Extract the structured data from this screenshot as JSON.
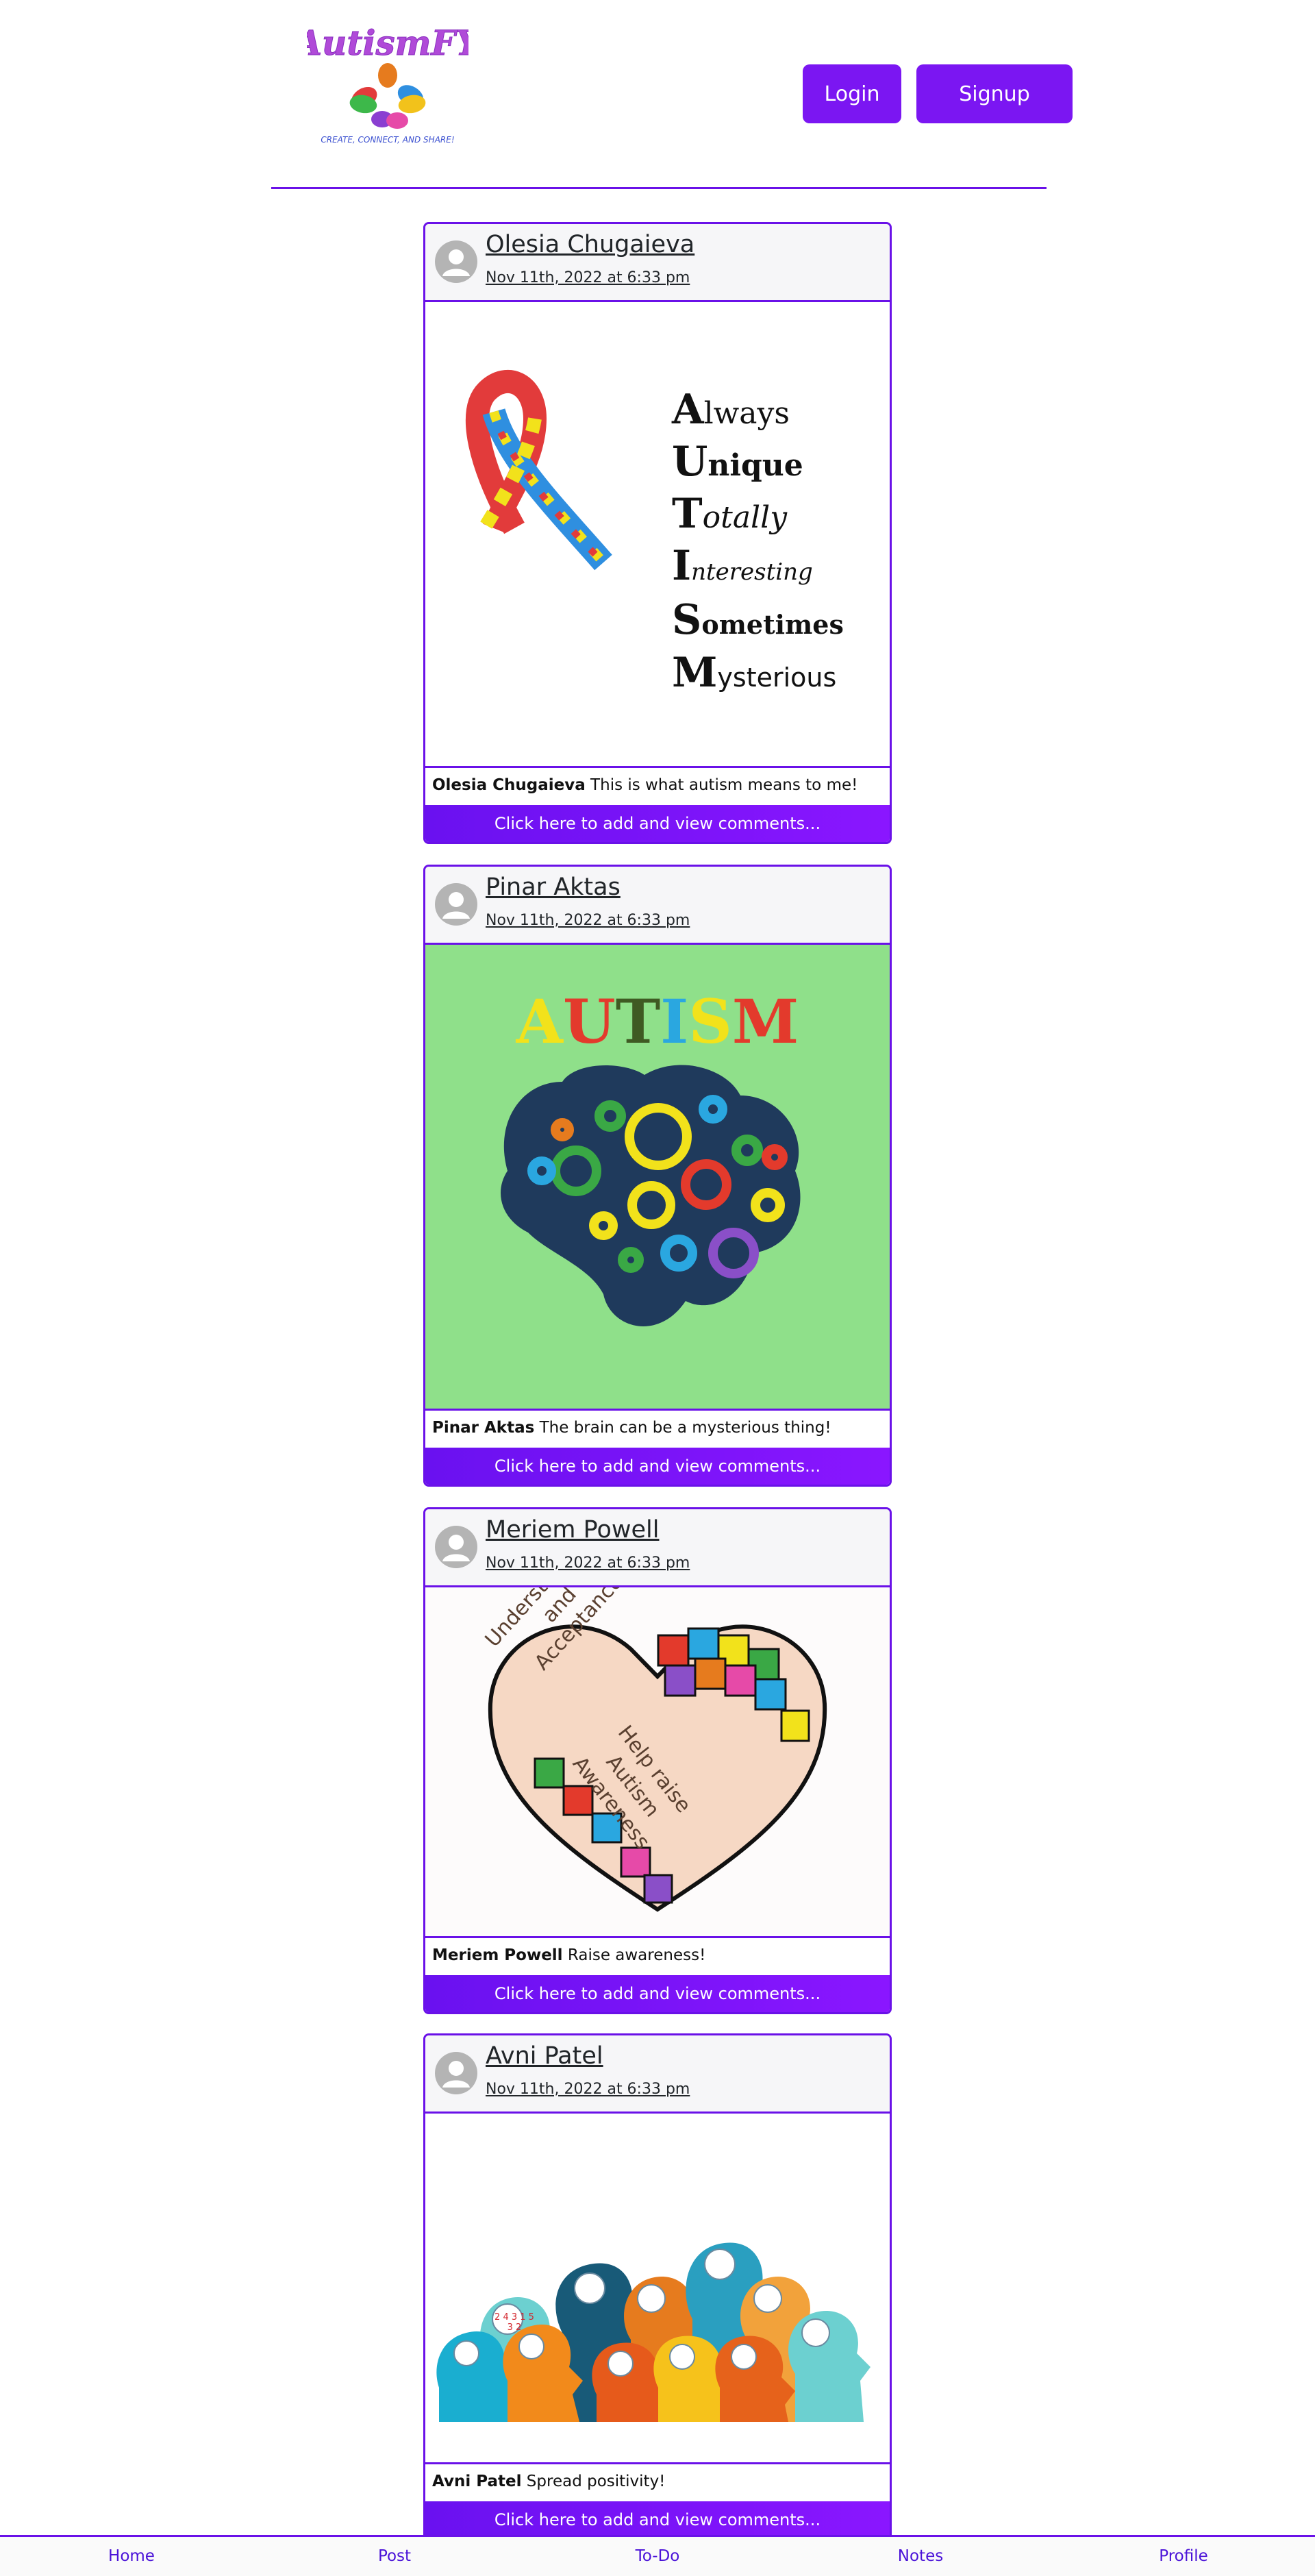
{
  "header": {
    "logo_text": "AutismFY",
    "logo_tagline": "CREATE, CONNECT, AND SHARE!",
    "login_label": "Login",
    "signup_label": "Signup"
  },
  "posts": [
    {
      "author": "Olesia Chugaieva",
      "date": "Nov 11th, 2022 at 6:33 pm",
      "caption_author": "Olesia Chugaieva",
      "caption_text": " This is what autism means to me!",
      "comments_label": "Click here to add and view comments...",
      "image": {
        "lines": [
          {
            "initial": "A",
            "rest": "lways",
            "color": "#3b3bd6"
          },
          {
            "initial": "U",
            "rest": "nique",
            "color": "#2ec4c8"
          },
          {
            "initial": "T",
            "rest": "otally",
            "color": "#e6d21a"
          },
          {
            "initial": "I",
            "rest": "nteresting",
            "color": "#d3262d"
          },
          {
            "initial": "S",
            "rest": "ometimes",
            "color": "#3aa845"
          },
          {
            "initial": "M",
            "rest": "ysterious",
            "color": "#7a2fb8"
          }
        ]
      }
    },
    {
      "author": "Pinar Aktas",
      "date": "Nov 11th, 2022 at 6:33 pm",
      "caption_author": "Pinar Aktas",
      "caption_text": " The brain can be a mysterious thing!",
      "comments_label": "Click here to add and view comments...",
      "image": {
        "letters": [
          {
            "char": "A",
            "color": "#f2e21b"
          },
          {
            "char": "U",
            "color": "#e33a2c"
          },
          {
            "char": "T",
            "color": "#3f5a23"
          },
          {
            "char": "I",
            "color": "#2aa7e0"
          },
          {
            "char": "S",
            "color": "#f2e21b"
          },
          {
            "char": "M",
            "color": "#e33a2c"
          }
        ]
      }
    },
    {
      "author": "Meriem Powell",
      "date": "Nov 11th, 2022 at 6:33 pm",
      "caption_author": "Meriem Powell",
      "caption_text": " Raise awareness!",
      "comments_label": "Click here to add and view comments...",
      "image": {
        "hand_left_text": [
          "Understanding",
          "and",
          "Acceptance"
        ],
        "hand_right_text": [
          "Help raise",
          "Autism",
          "Awareness"
        ]
      }
    },
    {
      "author": "Avni Patel",
      "date": "Nov 11th, 2022 at 6:33 pm",
      "caption_author": "Avni Patel",
      "caption_text": " Spread positivity!",
      "comments_label": "Click here to add and view comments...",
      "image": {
        "numbers": "2 4 3 1 5 3 2"
      }
    }
  ],
  "bottom_nav": {
    "items": [
      {
        "label": "Home"
      },
      {
        "label": "Post"
      },
      {
        "label": "To-Do"
      },
      {
        "label": "Notes"
      },
      {
        "label": "Profile"
      }
    ]
  },
  "colors": {
    "accent": "#6a11e8",
    "button": "#7b16f2",
    "nav_text": "#4a12d8",
    "card_head_bg": "#f6f6f8",
    "post2_bg": "#8fe08a"
  }
}
